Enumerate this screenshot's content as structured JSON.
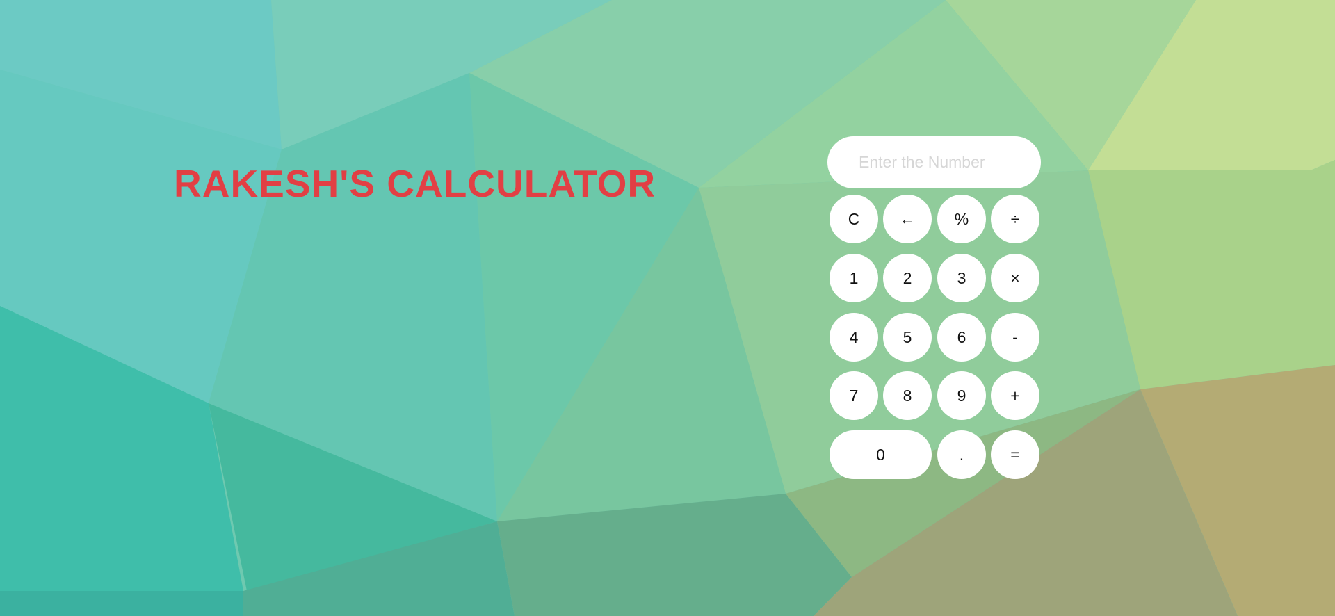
{
  "page": {
    "title": "RAKESH'S CALCULATOR",
    "title_color": "#e23f44",
    "background_style": "low-poly gradient (teal to green to olive)"
  },
  "display": {
    "placeholder": "Enter the Number",
    "value": ""
  },
  "keypad": {
    "rows": [
      [
        {
          "label": "C",
          "name": "clear-button"
        },
        {
          "label": "←",
          "name": "backspace-button"
        },
        {
          "label": "%",
          "name": "percent-button"
        },
        {
          "label": "÷",
          "name": "divide-button"
        }
      ],
      [
        {
          "label": "1",
          "name": "digit-1-button"
        },
        {
          "label": "2",
          "name": "digit-2-button"
        },
        {
          "label": "3",
          "name": "digit-3-button"
        },
        {
          "label": "×",
          "name": "multiply-button"
        }
      ],
      [
        {
          "label": "4",
          "name": "digit-4-button"
        },
        {
          "label": "5",
          "name": "digit-5-button"
        },
        {
          "label": "6",
          "name": "digit-6-button"
        },
        {
          "label": "-",
          "name": "subtract-button"
        }
      ],
      [
        {
          "label": "7",
          "name": "digit-7-button"
        },
        {
          "label": "8",
          "name": "digit-8-button"
        },
        {
          "label": "9",
          "name": "digit-9-button"
        },
        {
          "label": "+",
          "name": "add-button"
        }
      ],
      [
        {
          "label": "0",
          "name": "digit-0-button",
          "wide": true
        },
        {
          "label": ".",
          "name": "decimal-button"
        },
        {
          "label": "=",
          "name": "equals-button"
        }
      ]
    ]
  }
}
